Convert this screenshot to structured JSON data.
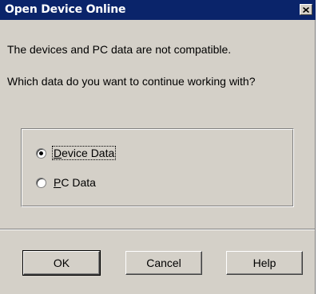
{
  "dialog": {
    "title": "Open Device Online",
    "close_icon": "close-icon"
  },
  "messages": {
    "line1": "The devices and PC data are not compatible.",
    "line2": "Which data do you want to continue working with?"
  },
  "options": [
    {
      "label_first": "D",
      "label_rest": "evice Data",
      "selected": true
    },
    {
      "label_first": "P",
      "label_rest": "C Data",
      "selected": false
    }
  ],
  "buttons": {
    "ok_label": "OK",
    "cancel_label": "Cancel",
    "help_label": "Help"
  }
}
